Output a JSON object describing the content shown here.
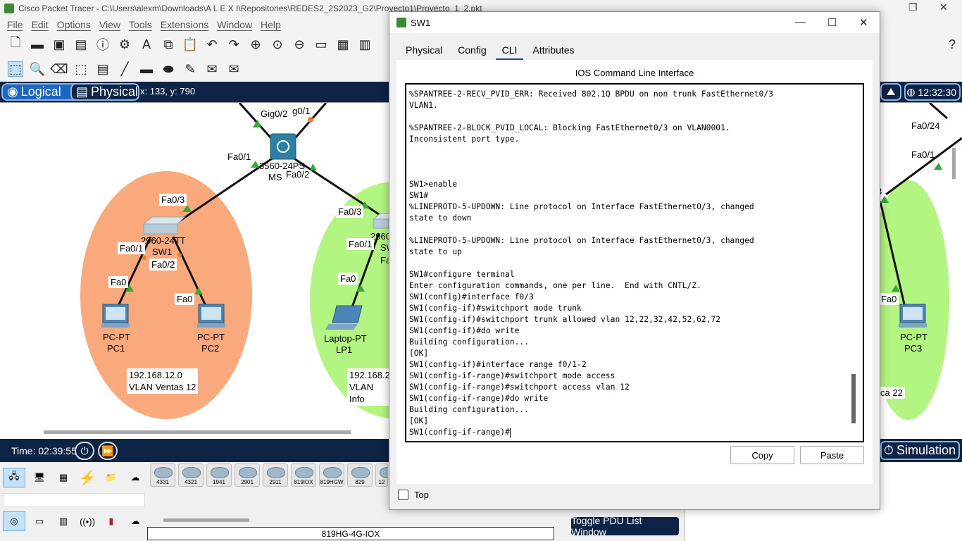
{
  "window": {
    "title": "Cisco Packet Tracer - C:\\Users\\alexm\\Downloads\\A L E X I\\Repositories\\REDES2_2S2023_G2\\Proyecto1\\Proyecto_1_2.pkt"
  },
  "menu": [
    "File",
    "Edit",
    "Options",
    "View",
    "Tools",
    "Extensions",
    "Window",
    "Help"
  ],
  "workspace_tabs": {
    "logical": "Logical",
    "physical": "Physical",
    "coords": "x: 133, y: 790",
    "clock": "12:32:30"
  },
  "topology": {
    "labels": {
      "gig02": "Gig0/2",
      "g01": "g0/1",
      "ms_fa01": "Fa0/1",
      "ms_fa02": "Fa0/2",
      "ms_name1": "3560-24PS",
      "ms_name2": "MS",
      "sw1_fa03": "Fa0/3",
      "sw1_fa01": "Fa0/1",
      "sw1_fa02": "Fa0/2",
      "sw1_model": "2960-24TT",
      "sw1_name": "SW1",
      "pc1_fa0": "Fa0",
      "pc2_fa0": "Fa0",
      "pc1_type": "PC-PT",
      "pc1_name": "PC1",
      "pc2_type": "PC-PT",
      "pc2_name": "PC2",
      "vlan_ventas_ip": "192.168.12.0",
      "vlan_ventas_name": "VLAN Ventas 12",
      "sw2_fa03": "Fa0/3",
      "sw2_fa01": "Fa0/1",
      "sw2_model": "2960",
      "sw2_name": "SW",
      "sw2_fa_partial": "Fa",
      "lp1_fa0": "Fa0",
      "lp1_type": "Laptop-PT",
      "lp1_name": "LP1",
      "vlan_info_ip": "192.168.2",
      "vlan_info_name": "VLAN Info",
      "right_fa024": "Fa0/24",
      "right_fa01": "Fa0/1",
      "right_3": "3",
      "pc3_fa0": "Fa0",
      "pc3_type": "PC-PT",
      "pc3_name": "PC3",
      "right_vlan": "ca 22"
    }
  },
  "status": {
    "time": "Time: 02:39:55",
    "simulation": "Simulation"
  },
  "device_tiles": [
    "4331",
    "4321",
    "1941",
    "2901",
    "2911",
    "819IOX",
    "819HGW",
    "829",
    "12"
  ],
  "selected_device": "819HG-4G-IOX",
  "pdu_button": "Toggle PDU List Window",
  "dialog": {
    "title": "SW1",
    "tabs": [
      "Physical",
      "Config",
      "CLI",
      "Attributes"
    ],
    "active_tab": "CLI",
    "header": "IOS Command Line Interface",
    "cli_lines": [
      "%SPANTREE-2-RECV_PVID_ERR: Received 802.1Q BPDU on non trunk FastEthernet0/3",
      "VLAN1.",
      "",
      "%SPANTREE-2-BLOCK_PVID_LOCAL: Blocking FastEthernet0/3 on VLAN0001.",
      "Inconsistent port type.",
      "",
      "",
      "",
      "SW1>enable",
      "SW1#",
      "%LINEPROTO-5-UPDOWN: Line protocol on Interface FastEthernet0/3, changed",
      "state to down",
      "",
      "%LINEPROTO-5-UPDOWN: Line protocol on Interface FastEthernet0/3, changed",
      "state to up",
      "",
      "SW1#configure terminal",
      "Enter configuration commands, one per line.  End with CNTL/Z.",
      "SW1(config)#interface f0/3",
      "SW1(config-if)#switchport mode trunk",
      "SW1(config-if)#switchport trunk allowed vlan 12,22,32,42,52,62,72",
      "SW1(config-if)#do write",
      "Building configuration...",
      "[OK]",
      "SW1(config-if)#interface range f0/1-2",
      "SW1(config-if-range)#switchport mode access",
      "SW1(config-if-range)#switchport access vlan 12",
      "SW1(config-if-range)#do write",
      "Building configuration...",
      "[OK]",
      "SW1(config-if-range)#"
    ],
    "copy_label": "Copy",
    "paste_label": "Paste",
    "top_label": "Top",
    "top_checked": false
  }
}
